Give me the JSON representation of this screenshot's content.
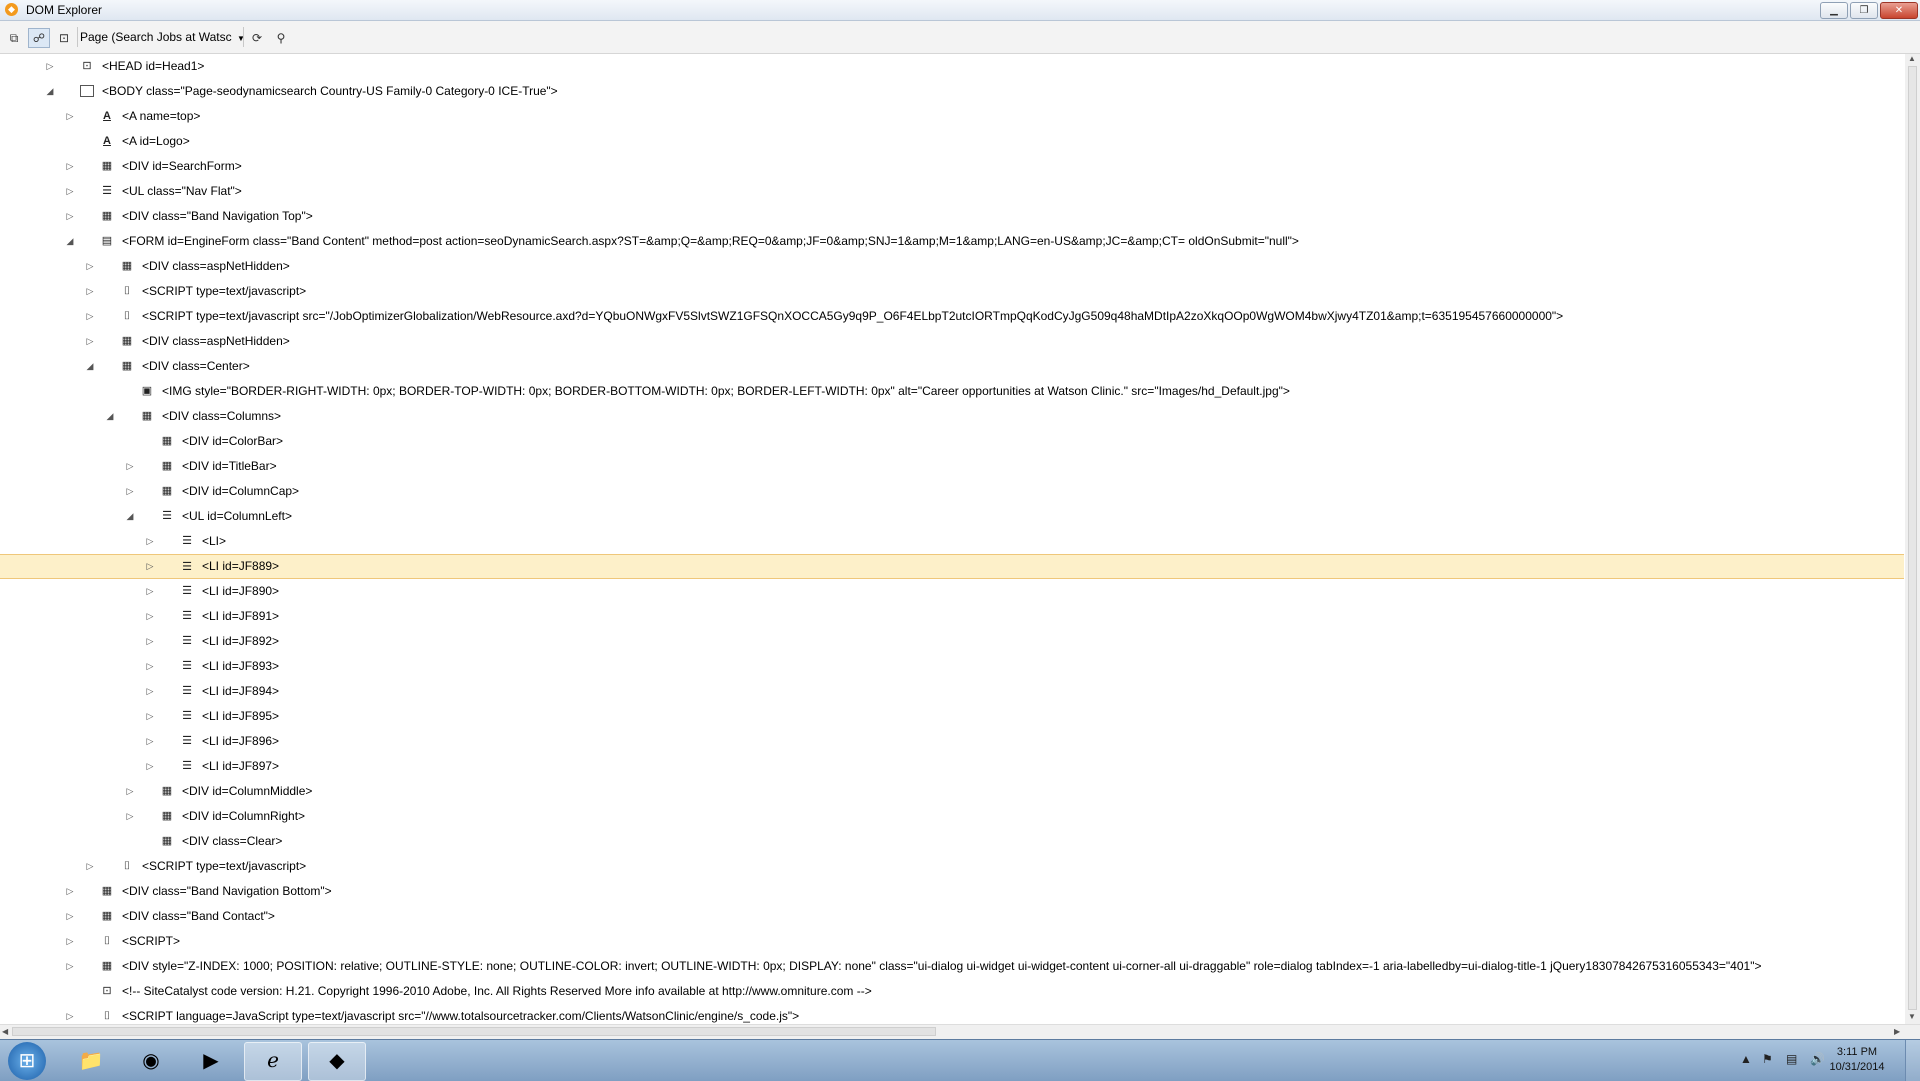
{
  "window": {
    "title": "DOM Explorer",
    "app_icon": "ie-developer-tools-icon"
  },
  "toolbar": {
    "page_select": "Page (Search Jobs at Watsc"
  },
  "tree": [
    {
      "depth": 1,
      "toggle": "collapsed",
      "icon": "code-element-icon",
      "label": "<HEAD id=Head1>"
    },
    {
      "depth": 1,
      "toggle": "expanded",
      "icon": "body-window-icon",
      "label": "<BODY class=\"Page-seodynamicsearch Country-US Family-0 Category-0 ICE-True\">"
    },
    {
      "depth": 2,
      "toggle": "collapsed",
      "icon": "anchor-icon",
      "label": "<A name=top>"
    },
    {
      "depth": 2,
      "toggle": "none",
      "icon": "anchor-icon",
      "label": "<A id=Logo>"
    },
    {
      "depth": 2,
      "toggle": "collapsed",
      "icon": "div-icon",
      "label": "<DIV id=SearchForm>"
    },
    {
      "depth": 2,
      "toggle": "collapsed",
      "icon": "list-icon",
      "label": "<UL class=\"Nav Flat\">"
    },
    {
      "depth": 2,
      "toggle": "collapsed",
      "icon": "div-icon",
      "label": "<DIV class=\"Band Navigation Top\">"
    },
    {
      "depth": 2,
      "toggle": "expanded",
      "icon": "form-icon",
      "label": "<FORM id=EngineForm class=\"Band Content\" method=post action=seoDynamicSearch.aspx?ST=&amp;Q=&amp;REQ=0&amp;JF=0&amp;SNJ=1&amp;M=1&amp;LANG=en-US&amp;JC=&amp;CT= oldOnSubmit=\"null\">"
    },
    {
      "depth": 3,
      "toggle": "collapsed",
      "icon": "div-icon",
      "label": "<DIV class=aspNetHidden>"
    },
    {
      "depth": 3,
      "toggle": "collapsed",
      "icon": "script-icon",
      "label": "<SCRIPT type=text/javascript>"
    },
    {
      "depth": 3,
      "toggle": "collapsed",
      "icon": "script-icon",
      "label": "<SCRIPT type=text/javascript src=\"/JobOptimizerGlobalization/WebResource.axd?d=YQbuONWgxFV5SlvtSWZ1GFSQnXOCCA5Gy9q9P_O6F4ELbpT2utcIORTmpQqKodCyJgG509q48haMDtIpA2zoXkqOOp0WgWOM4bwXjwy4TZ01&amp;t=635195457660000000\">"
    },
    {
      "depth": 3,
      "toggle": "collapsed",
      "icon": "div-icon",
      "label": "<DIV class=aspNetHidden>"
    },
    {
      "depth": 3,
      "toggle": "expanded",
      "icon": "div-icon",
      "label": "<DIV class=Center>"
    },
    {
      "depth": 4,
      "toggle": "none",
      "icon": "image-icon",
      "label": "<IMG style=\"BORDER-RIGHT-WIDTH: 0px; BORDER-TOP-WIDTH: 0px; BORDER-BOTTOM-WIDTH: 0px; BORDER-LEFT-WIDTH: 0px\" alt=\"Career opportunities at Watson Clinic.\" src=\"Images/hd_Default.jpg\">"
    },
    {
      "depth": 4,
      "toggle": "expanded",
      "icon": "div-icon",
      "label": "<DIV class=Columns>"
    },
    {
      "depth": 5,
      "toggle": "none",
      "icon": "div-icon",
      "label": "<DIV id=ColorBar>"
    },
    {
      "depth": 5,
      "toggle": "collapsed",
      "icon": "div-icon",
      "label": "<DIV id=TitleBar>"
    },
    {
      "depth": 5,
      "toggle": "collapsed",
      "icon": "div-icon",
      "label": "<DIV id=ColumnCap>"
    },
    {
      "depth": 5,
      "toggle": "expanded",
      "icon": "list-icon",
      "label": "<UL id=ColumnLeft>"
    },
    {
      "depth": 6,
      "toggle": "collapsed",
      "icon": "list-icon",
      "label": "<LI>"
    },
    {
      "depth": 6,
      "toggle": "collapsed",
      "icon": "list-icon",
      "label": "<LI id=JF889>",
      "selected": true
    },
    {
      "depth": 6,
      "toggle": "collapsed",
      "icon": "list-icon",
      "label": "<LI id=JF890>"
    },
    {
      "depth": 6,
      "toggle": "collapsed",
      "icon": "list-icon",
      "label": "<LI id=JF891>"
    },
    {
      "depth": 6,
      "toggle": "collapsed",
      "icon": "list-icon",
      "label": "<LI id=JF892>"
    },
    {
      "depth": 6,
      "toggle": "collapsed",
      "icon": "list-icon",
      "label": "<LI id=JF893>"
    },
    {
      "depth": 6,
      "toggle": "collapsed",
      "icon": "list-icon",
      "label": "<LI id=JF894>"
    },
    {
      "depth": 6,
      "toggle": "collapsed",
      "icon": "list-icon",
      "label": "<LI id=JF895>"
    },
    {
      "depth": 6,
      "toggle": "collapsed",
      "icon": "list-icon",
      "label": "<LI id=JF896>"
    },
    {
      "depth": 6,
      "toggle": "collapsed",
      "icon": "list-icon",
      "label": "<LI id=JF897>"
    },
    {
      "depth": 5,
      "toggle": "collapsed",
      "icon": "div-icon",
      "label": "<DIV id=ColumnMiddle>"
    },
    {
      "depth": 5,
      "toggle": "collapsed",
      "icon": "div-icon",
      "label": "<DIV id=ColumnRight>"
    },
    {
      "depth": 5,
      "toggle": "none",
      "icon": "div-icon",
      "label": "<DIV class=Clear>"
    },
    {
      "depth": 3,
      "toggle": "collapsed",
      "icon": "script-icon",
      "label": "<SCRIPT type=text/javascript>"
    },
    {
      "depth": 2,
      "toggle": "collapsed",
      "icon": "div-icon",
      "label": "<DIV class=\"Band Navigation Bottom\">"
    },
    {
      "depth": 2,
      "toggle": "collapsed",
      "icon": "div-icon",
      "label": "<DIV class=\"Band Contact\">"
    },
    {
      "depth": 2,
      "toggle": "collapsed",
      "icon": "script-icon",
      "label": "<SCRIPT>"
    },
    {
      "depth": 2,
      "toggle": "collapsed",
      "icon": "div-icon",
      "label": "<DIV style=\"Z-INDEX: 1000; POSITION: relative; OUTLINE-STYLE: none; OUTLINE-COLOR: invert; OUTLINE-WIDTH: 0px; DISPLAY: none\" class=\"ui-dialog ui-widget ui-widget-content ui-corner-all ui-draggable\" role=dialog tabIndex=-1 aria-labelledby=ui-dialog-title-1 jQuery18307842675316055343=\"401\">"
    },
    {
      "depth": 2,
      "toggle": "none",
      "icon": "comment-icon",
      "label": "<!-- SiteCatalyst code version: H.21. Copyright 1996-2010 Adobe, Inc. All Rights Reserved More info available at http://www.omniture.com -->"
    },
    {
      "depth": 2,
      "toggle": "collapsed",
      "icon": "script-icon",
      "label": "<SCRIPT language=JavaScript type=text/javascript src=\"//www.totalsourcetracker.com/Clients/WatsonClinic/engine/s_code.js\">"
    }
  ],
  "taskbar": {
    "apps": [
      "file-explorer-icon",
      "chrome-icon",
      "media-player-icon",
      "internet-explorer-icon",
      "ts-app-icon"
    ],
    "clock_time": "3:11 PM",
    "clock_date": "10/31/2014"
  }
}
